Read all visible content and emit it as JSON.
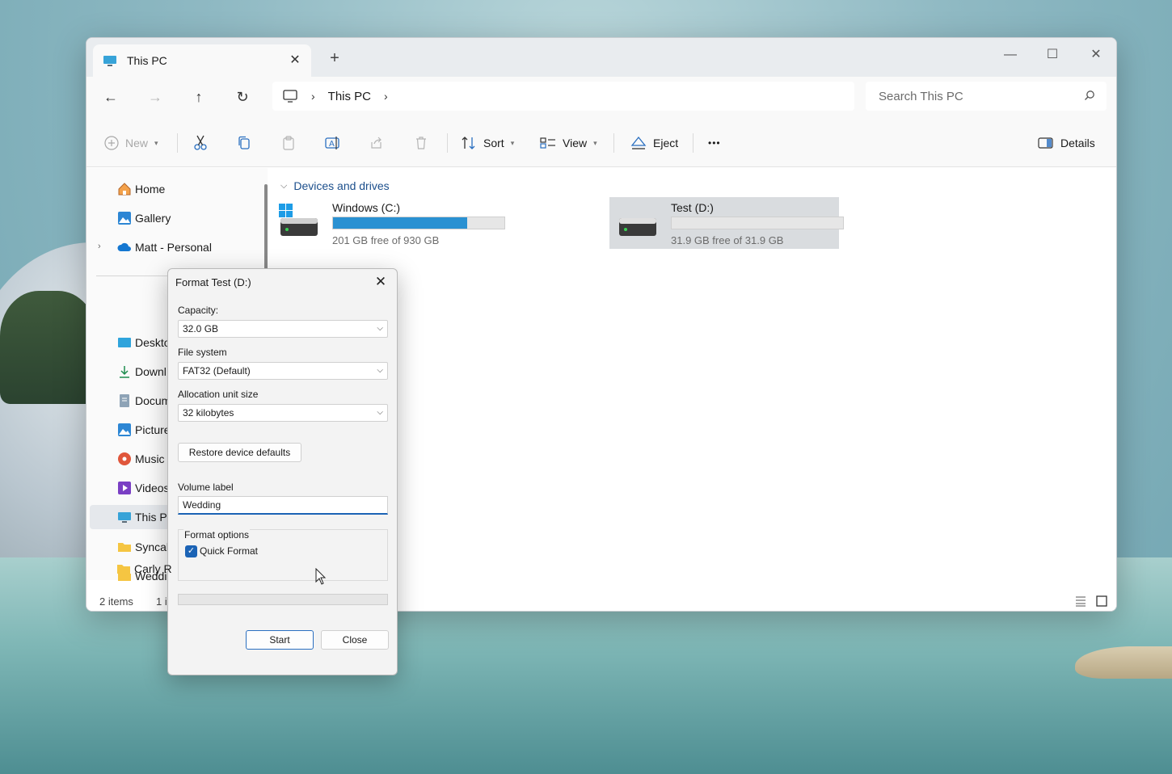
{
  "tab": {
    "title": "This PC",
    "close": "✕",
    "new": "+"
  },
  "window_controls": {
    "minimize": "—",
    "maximize": "☐",
    "close": "✕"
  },
  "nav": {
    "back": "←",
    "forward": "→",
    "up": "↑",
    "refresh": "↻"
  },
  "address": {
    "crumb": "This PC",
    "sep": "›"
  },
  "search": {
    "placeholder": "Search This PC"
  },
  "toolbar": {
    "new_label": "New",
    "sort_label": "Sort",
    "view_label": "View",
    "eject_label": "Eject",
    "more_label": "•••",
    "details_label": "Details"
  },
  "sidebar": {
    "items": [
      {
        "label": "Home"
      },
      {
        "label": "Gallery"
      },
      {
        "label": "Matt - Personal"
      },
      {
        "label": "Deskto"
      },
      {
        "label": "Downl"
      },
      {
        "label": "Docum"
      },
      {
        "label": "Picture"
      },
      {
        "label": "Music"
      },
      {
        "label": "Videos"
      },
      {
        "label": "This PC"
      },
      {
        "label": "Syncall"
      },
      {
        "label": "Weddi"
      },
      {
        "label": "Carly R"
      }
    ]
  },
  "content": {
    "group_title": "Devices and drives",
    "drives": [
      {
        "name": "Windows (C:)",
        "free": "201 GB free of 930 GB",
        "used_fraction": 0.784
      },
      {
        "name": "Test (D:)",
        "free": "31.9 GB free of 31.9 GB",
        "used_fraction": 0.0
      }
    ]
  },
  "status": {
    "items": "2 items",
    "selected": "1 i"
  },
  "dialog": {
    "title": "Format Test (D:)",
    "close": "✕",
    "capacity_label": "Capacity:",
    "capacity_value": "32.0 GB",
    "fs_label": "File system",
    "fs_value": "FAT32 (Default)",
    "alloc_label": "Allocation unit size",
    "alloc_value": "32 kilobytes",
    "restore_label": "Restore device defaults",
    "volume_label": "Volume label",
    "volume_value": "Wedding",
    "options_title": "Format options",
    "quick_format": "Quick Format",
    "quick_format_checked": true,
    "start_label": "Start",
    "close_label": "Close",
    "progress": 0
  },
  "colors": {
    "accent": "#1b63b5",
    "drive_fill": "#2a91d2",
    "group_title": "#1c4f8c"
  }
}
